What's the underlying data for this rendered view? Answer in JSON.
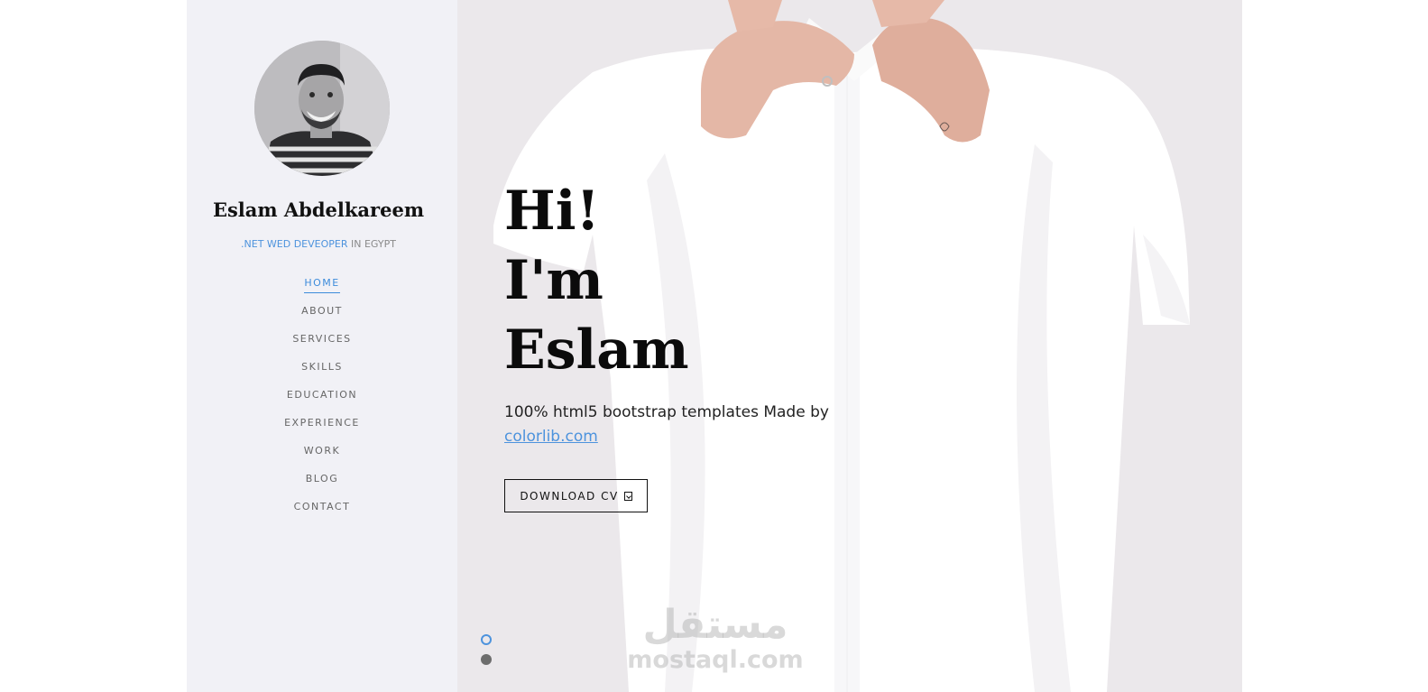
{
  "sidebar": {
    "name": "Eslam Abdelkareem",
    "tagline_role": ".NET WED DEVEOPER",
    "tagline_location": " IN EGYPT",
    "nav": [
      {
        "label": "HOME",
        "active": true
      },
      {
        "label": "ABOUT",
        "active": false
      },
      {
        "label": "SERVICES",
        "active": false
      },
      {
        "label": "SKILLS",
        "active": false
      },
      {
        "label": "EDUCATION",
        "active": false
      },
      {
        "label": "EXPERIENCE",
        "active": false
      },
      {
        "label": "WORK",
        "active": false
      },
      {
        "label": "BLOG",
        "active": false
      },
      {
        "label": "CONTACT",
        "active": false
      }
    ]
  },
  "hero": {
    "title_lines": [
      "Hi!",
      "I'm",
      "Eslam"
    ],
    "text_prefix": "100% html5 bootstrap templates Made by ",
    "link_text": "colorlib.com",
    "button_label": "DOWNLOAD CV",
    "slides": {
      "total": 2,
      "active": 1
    }
  },
  "watermark": {
    "arabic": "مستقل",
    "latin": "mostaql.com"
  },
  "colors": {
    "accent": "#4d93dd",
    "sidebar_bg": "#f1f1f6",
    "text_dark": "#111111"
  },
  "icons": {
    "button_icon": "download-icon"
  }
}
